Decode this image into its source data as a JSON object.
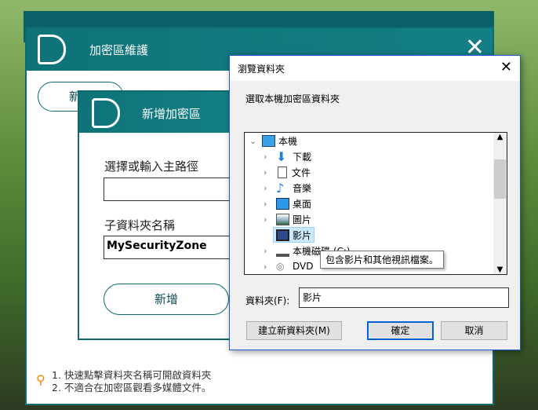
{
  "main_window": {
    "title": "加密區維護",
    "add_button": "新增",
    "close": "✕"
  },
  "tips": [
    "1. 快速點擊資料夾名稱可開啟資料夾",
    "2. 不適合在加密區觀看多媒體文件。"
  ],
  "add_window": {
    "title": "新增加密區",
    "path_label": "選擇或輸入主路徑",
    "path_value": "",
    "subfolder_label": "子資料夾名稱",
    "subfolder_value": "MySecurityZone",
    "add_button": "新增"
  },
  "dialog": {
    "title": "瀏覽資料夾",
    "instruction": "選取本機加密區資料夾",
    "tree": [
      {
        "label": "本機",
        "icon": "computer-icon",
        "expanded": true
      },
      {
        "label": "下載",
        "icon": "download-icon"
      },
      {
        "label": "文件",
        "icon": "document-icon"
      },
      {
        "label": "音樂",
        "icon": "music-icon"
      },
      {
        "label": "桌面",
        "icon": "desktop-icon"
      },
      {
        "label": "圖片",
        "icon": "picture-icon"
      },
      {
        "label": "影片",
        "icon": "video-icon",
        "selected": true
      },
      {
        "label": "本機磁碟 (C:)",
        "icon": "drive-icon"
      },
      {
        "label": "DVD",
        "icon": "dvd-icon"
      }
    ],
    "tooltip": "包含影片和其他視訊檔案。",
    "folder_label": "資料夾(F):",
    "folder_value": "影片",
    "new_folder_button": "建立新資料夾(M)",
    "ok_button": "確定",
    "cancel_button": "取消"
  },
  "colors": {
    "teal": "#0e7379",
    "accent_blue": "#0063d1"
  }
}
